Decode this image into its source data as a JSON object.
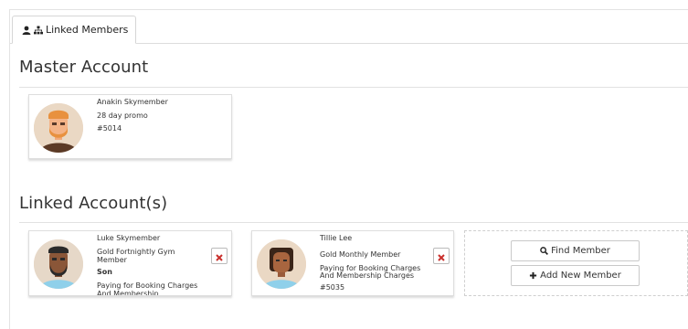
{
  "tab": {
    "label": "Linked Members"
  },
  "master": {
    "heading": "Master Account",
    "member": {
      "name": "Anakin Skymember",
      "plan": "28 day promo",
      "id": "#5014"
    }
  },
  "linked": {
    "heading": "Linked Account(s)",
    "members": [
      {
        "name": "Luke Skymember",
        "plan": "Gold Fortnightly Gym Member",
        "relation": "Son",
        "payment": "Paying for Booking Charges And Membership"
      },
      {
        "name": "Tillie Lee",
        "plan": "Gold Monthly Member",
        "payment": "Paying for Booking Charges And Membership Charges",
        "id": "#5035"
      }
    ]
  },
  "actions": {
    "find_label": "Find Member",
    "add_label": "Add New Member"
  },
  "colors": {
    "remove_icon": "#c9302c",
    "border": "#dedede"
  }
}
